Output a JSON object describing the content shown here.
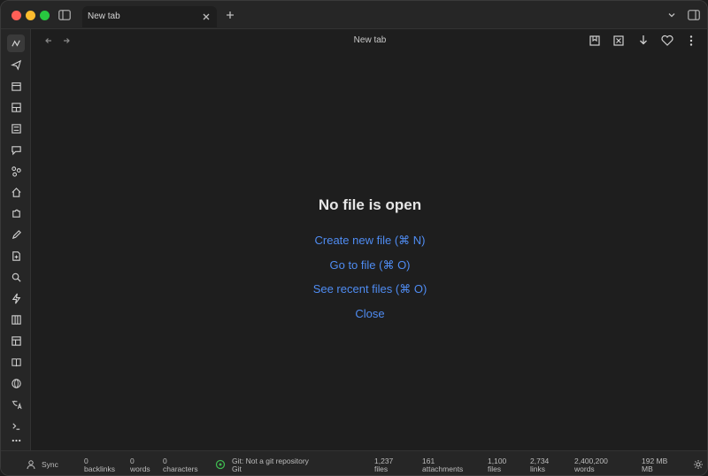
{
  "tab": {
    "title": "New tab"
  },
  "view": {
    "title": "New tab"
  },
  "empty_state": {
    "title": "No file is open",
    "actions": [
      "Create new file (⌘ N)",
      "Go to file (⌘ O)",
      "See recent files (⌘ O)",
      "Close"
    ]
  },
  "status": {
    "sync": "Sync",
    "backlinks_count": "0",
    "backlinks_label": "backlinks",
    "words_count": "0",
    "words_label": "words",
    "characters_count": "0",
    "characters_label": "characters",
    "git_text": "Git: Not a git repository",
    "git_sub": "Git",
    "files_count": "1,237",
    "files_label": "files",
    "attachments_count": "161",
    "attachments_label": "attachments",
    "stat_a_value": "1,100",
    "stat_a_label": "files",
    "stat_b_value": "2,734",
    "stat_b_label": "links",
    "stat_c_value": "2,400,200",
    "stat_c_label": "words",
    "size_value": "192 MB",
    "size_label": "MB"
  },
  "colors": {
    "accent_link": "#4f8cf2",
    "background": "#1e1e1e",
    "chrome": "#262626",
    "traffic_red": "#fe5f57",
    "traffic_yellow": "#febc2e",
    "traffic_green": "#28c840"
  },
  "icons": {
    "ribbon": [
      "switcher-icon",
      "send-icon",
      "calendar-icon",
      "layout-icon",
      "template-icon",
      "chat-icon",
      "graph-icon",
      "home-icon",
      "puzzle-icon",
      "pen-icon",
      "file-plus-icon",
      "search-icon",
      "bolt-icon",
      "kanban-icon",
      "table-icon",
      "book-icon",
      "globe-icon",
      "translate-icon",
      "terminal-icon",
      "more-icon"
    ]
  }
}
